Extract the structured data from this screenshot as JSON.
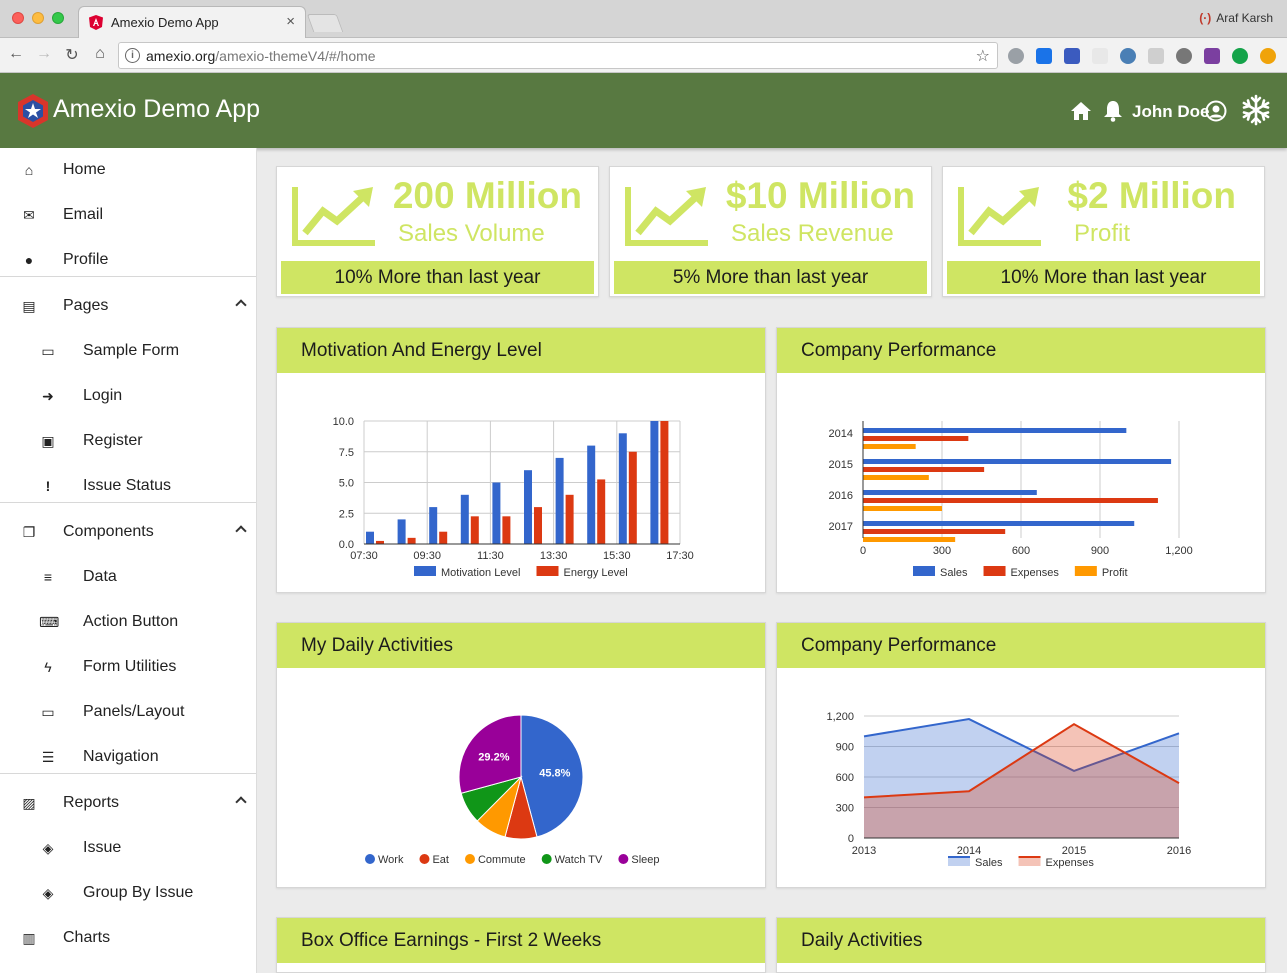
{
  "browser": {
    "tab_title": "Amexio Demo App",
    "tab_close": "×",
    "url_host": "amexio.org",
    "url_path": "/amexio-themeV4/#/home",
    "profile_name": "Araf Karsh",
    "nav_back": "←",
    "nav_forward": "→",
    "nav_reload": "↻",
    "nav_home": "⌂",
    "bookmark_star": "☆"
  },
  "app": {
    "title": "Amexio Demo App",
    "user_name": "John Doe",
    "header_color": "#587941",
    "accent_color": "#cfe563"
  },
  "sidebar": {
    "items": [
      {
        "label": "Home",
        "icon": "home-icon"
      },
      {
        "label": "Email",
        "icon": "envelope-icon"
      },
      {
        "label": "Profile",
        "icon": "user-icon"
      },
      {
        "label": "Pages",
        "icon": "id-card-icon",
        "expanded": true
      },
      {
        "label": "Sample Form",
        "icon": "laptop-icon"
      },
      {
        "label": "Login",
        "icon": "sign-in-icon"
      },
      {
        "label": "Register",
        "icon": "address-card-icon"
      },
      {
        "label": "Issue Status",
        "icon": "exclamation-icon"
      },
      {
        "label": "Components",
        "icon": "clone-icon",
        "expanded": true
      },
      {
        "label": "Data",
        "icon": "database-icon"
      },
      {
        "label": "Action Button",
        "icon": "keyboard-icon"
      },
      {
        "label": "Form Utilities",
        "icon": "bolt-icon"
      },
      {
        "label": "Panels/Layout",
        "icon": "desktop-icon"
      },
      {
        "label": "Navigation",
        "icon": "bars-icon"
      },
      {
        "label": "Reports",
        "icon": "image-icon",
        "expanded": true
      },
      {
        "label": "Issue",
        "icon": "ticket-icon"
      },
      {
        "label": "Group By Issue",
        "icon": "ticket-icon"
      },
      {
        "label": "Charts",
        "icon": "bar-chart-icon"
      }
    ]
  },
  "kpis": [
    {
      "value": "200 Million",
      "label": "Sales Volume",
      "footer": "10% More than last year"
    },
    {
      "value": "$10 Million",
      "label": "Sales Revenue",
      "footer": "5% More than last year"
    },
    {
      "value": "$2 Million",
      "label": "Profit",
      "footer": "10% More than last year"
    }
  ],
  "panels": {
    "motivation": "Motivation And Energy Level",
    "performance_bar": "Company Performance",
    "daily": "My Daily Activities",
    "performance_area": "Company Performance",
    "box_office": "Box Office Earnings - First 2 Weeks",
    "daily_activities": "Daily Activities"
  },
  "chart_data": [
    {
      "type": "bar",
      "x_ticks": [
        "07:30",
        "09:30",
        "11:30",
        "13:30",
        "15:30",
        "17:30"
      ],
      "y_ticks": [
        "0.0",
        "2.5",
        "5.0",
        "7.5",
        "10.0"
      ],
      "ylim": [
        0,
        10
      ],
      "x": [
        7.5,
        8.5,
        9.5,
        10.5,
        11.5,
        12.5,
        13.5,
        14.5,
        15.5,
        16.5
      ],
      "xlim": [
        7.5,
        17.5
      ],
      "series": [
        {
          "name": "Motivation Level",
          "color": "#3366cc",
          "values": [
            1,
            2,
            3,
            4,
            5,
            6,
            7,
            8,
            9,
            10
          ]
        },
        {
          "name": "Energy Level",
          "color": "#dc3912",
          "values": [
            0.25,
            0.5,
            1,
            2.25,
            2.25,
            3,
            4,
            5.25,
            7.5,
            10
          ]
        }
      ]
    },
    {
      "type": "bar",
      "orientation": "horizontal",
      "categories": [
        "2014",
        "2015",
        "2016",
        "2017"
      ],
      "x_ticks": [
        "0",
        "300",
        "600",
        "900",
        "1,200"
      ],
      "xlim": [
        0,
        1200
      ],
      "series": [
        {
          "name": "Sales",
          "color": "#3366cc",
          "values": [
            1000,
            1170,
            660,
            1030
          ]
        },
        {
          "name": "Expenses",
          "color": "#dc3912",
          "values": [
            400,
            460,
            1120,
            540
          ]
        },
        {
          "name": "Profit",
          "color": "#ff9900",
          "values": [
            200,
            250,
            300,
            350
          ]
        }
      ]
    },
    {
      "type": "pie",
      "slices": [
        {
          "name": "Work",
          "value": 45.8,
          "label": "45.8%",
          "color": "#3366cc"
        },
        {
          "name": "Eat",
          "value": 8.3,
          "color": "#dc3912"
        },
        {
          "name": "Commute",
          "value": 8.3,
          "color": "#ff9900"
        },
        {
          "name": "Watch TV",
          "value": 8.3,
          "color": "#109618"
        },
        {
          "name": "Sleep",
          "value": 29.2,
          "label": "29.2%",
          "color": "#990099"
        }
      ]
    },
    {
      "type": "area",
      "categories": [
        "2013",
        "2014",
        "2015",
        "2016"
      ],
      "y_ticks": [
        "0",
        "300",
        "600",
        "900",
        "1,200"
      ],
      "ylim": [
        0,
        1200
      ],
      "series": [
        {
          "name": "Sales",
          "color": "#3366cc",
          "values": [
            1000,
            1170,
            660,
            1030
          ]
        },
        {
          "name": "Expenses",
          "color": "#dc3912",
          "values": [
            400,
            460,
            1120,
            540
          ]
        }
      ]
    }
  ]
}
